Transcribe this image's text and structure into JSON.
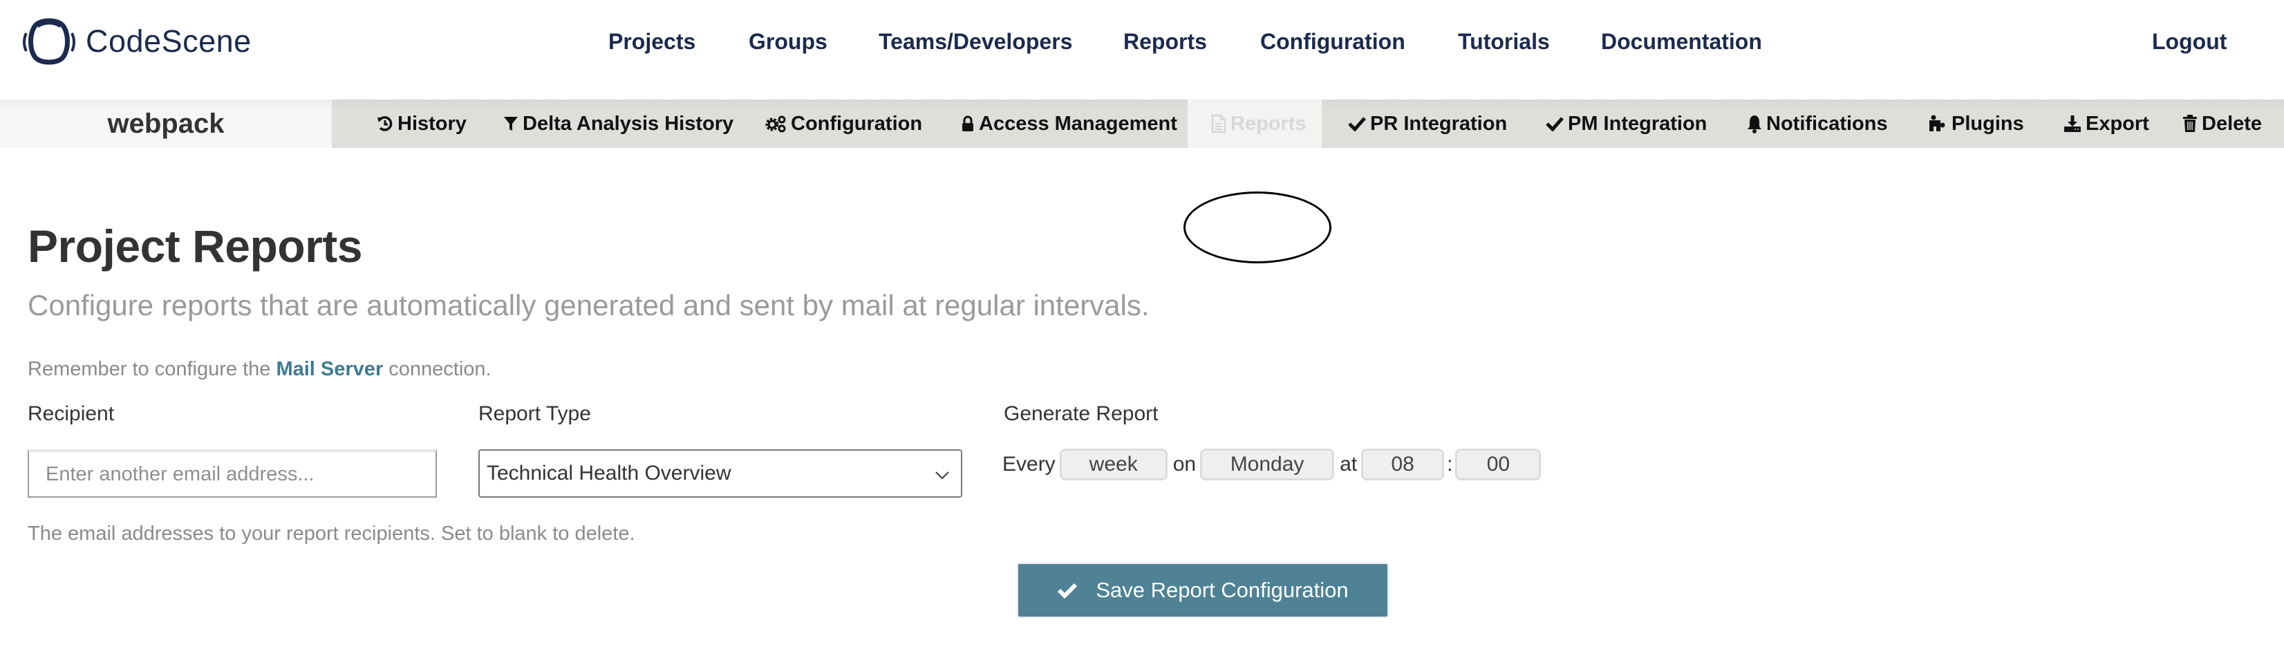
{
  "header": {
    "brand": "CodeScene",
    "nav": [
      {
        "label": "Projects"
      },
      {
        "label": "Groups"
      },
      {
        "label": "Teams/Developers"
      },
      {
        "label": "Reports"
      },
      {
        "label": "Configuration"
      },
      {
        "label": "Tutorials"
      },
      {
        "label": "Documentation"
      }
    ],
    "logout": "Logout"
  },
  "subnav": {
    "project_name": "webpack",
    "items": [
      {
        "label": "History",
        "icon": "history-icon"
      },
      {
        "label": "Delta Analysis History",
        "icon": "filter-icon"
      },
      {
        "label": "Configuration",
        "icon": "gears-icon"
      },
      {
        "label": "Access Management",
        "icon": "lock-icon"
      },
      {
        "label": "Reports",
        "icon": "file-text-icon",
        "active": true
      },
      {
        "label": "PR Integration",
        "icon": "check-icon"
      },
      {
        "label": "PM Integration",
        "icon": "check-icon"
      },
      {
        "label": "Notifications",
        "icon": "bell-icon"
      },
      {
        "label": "Plugins",
        "icon": "puzzle-icon"
      },
      {
        "label": "Export",
        "icon": "download-icon"
      },
      {
        "label": "Delete",
        "icon": "trash-icon"
      }
    ]
  },
  "page": {
    "title": "Project Reports",
    "subtitle": "Configure reports that are automatically generated and sent by mail at regular intervals.",
    "mail_note": {
      "before": "Remember to configure the ",
      "link": "Mail Server",
      "after": " connection."
    }
  },
  "form": {
    "recipient": {
      "label": "Recipient",
      "value": "",
      "placeholder": "Enter another email address...",
      "help": "The email addresses to your report recipients. Set to blank to delete."
    },
    "report_type": {
      "label": "Report Type",
      "selected": "Technical Health Overview"
    },
    "schedule": {
      "label": "Generate Report",
      "every_word": "Every",
      "interval": "week",
      "on_word": "on",
      "day": "Monday",
      "at_word": "at",
      "hour": "08",
      "separator": ":",
      "minute": "00"
    },
    "save_label": "Save Report Configuration"
  },
  "colors": {
    "brand_navy": "#1b2a4e",
    "accent_teal": "#4e8294",
    "link": "#3f7a91",
    "subnav_bg": "#e0dedb"
  }
}
